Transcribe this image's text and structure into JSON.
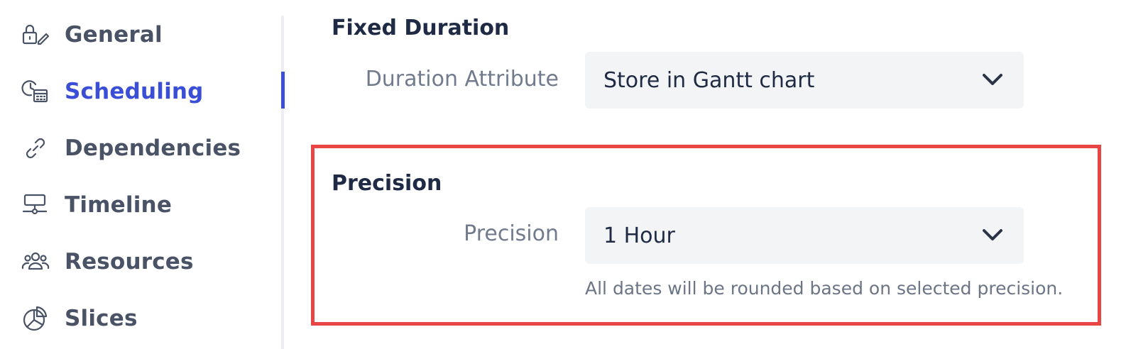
{
  "sidebar": {
    "items": [
      {
        "label": "General",
        "icon": "lock-pencil-icon",
        "active": false
      },
      {
        "label": "Scheduling",
        "icon": "clock-calendar-icon",
        "active": true
      },
      {
        "label": "Dependencies",
        "icon": "link-icon",
        "active": false
      },
      {
        "label": "Timeline",
        "icon": "timeline-icon",
        "active": false
      },
      {
        "label": "Resources",
        "icon": "users-icon",
        "active": false
      },
      {
        "label": "Slices",
        "icon": "pie-chart-icon",
        "active": false
      }
    ],
    "active_color": "#3b4fd6",
    "text_color": "#4a5365"
  },
  "fixed_duration": {
    "title": "Fixed Duration",
    "duration_attribute_label": "Duration Attribute",
    "duration_attribute_value": "Store in Gantt chart"
  },
  "precision": {
    "title": "Precision",
    "label": "Precision",
    "value": "1 Hour",
    "help": "All dates will be rounded based on selected precision."
  },
  "highlight_color": "#e94545"
}
